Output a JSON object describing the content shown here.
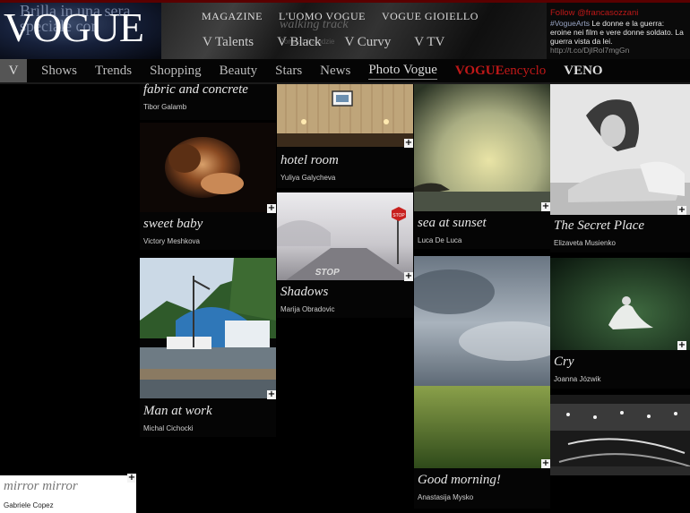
{
  "header": {
    "logo": "VOGUE",
    "promo_text": "Brilla in una sera speciale con",
    "ghost_title": "walking track",
    "ghost_author": "Tomasz Kolodzie"
  },
  "top_nav": [
    "MAGAZINE",
    "L'UOMO VOGUE",
    "VOGUE GIOIELLO"
  ],
  "sub_nav": [
    "V Talents",
    "V Black",
    "V Curvy",
    "V TV"
  ],
  "twitter": {
    "follow": "Follow @francasozzani",
    "hashtag": "#VogueArts",
    "body": "Le donne e la guerra: eroine nei film e vere donne soldato. La guerra vista da lei.",
    "link": "http://t.co/DjIRol7mgGn"
  },
  "main_nav": {
    "v": "V",
    "items": [
      "Shows",
      "Trends",
      "Shopping",
      "Beauty",
      "Stars",
      "News",
      "Photo Vogue"
    ],
    "encyclo_bold": "VOGUE",
    "encyclo_rest": "encyclo",
    "veno": "VENO"
  },
  "photos": [
    {
      "title": "fabric and concrete",
      "author": "Tibor Galamb"
    },
    {
      "title": "sweet baby",
      "author": "Victory Meshkova"
    },
    {
      "title": "Man at work",
      "author": "Michal Cichocki"
    },
    {
      "title": "hotel room",
      "author": "Yuliya Galycheva"
    },
    {
      "title": "Shadows",
      "author": "Marija Obradovic"
    },
    {
      "title": "sea at sunset",
      "author": "Luca De Luca"
    },
    {
      "title": "Good morning!",
      "author": "Anastasija Mysko"
    },
    {
      "title": "The Secret Place",
      "author": "Elizaveta Musienko"
    },
    {
      "title": "Cry",
      "author": "Joanna Józwik"
    },
    {
      "title": "mirror mirror",
      "author": "Gabriele Copez"
    }
  ],
  "stop_sign": "STOP",
  "road_text": "STOP"
}
